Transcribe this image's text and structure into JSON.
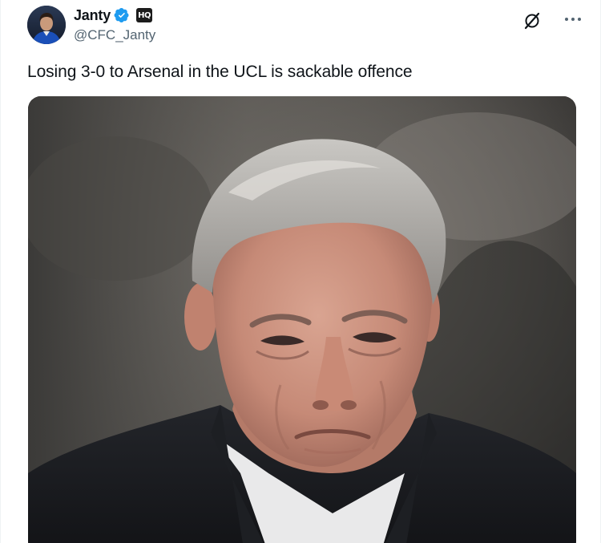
{
  "author": {
    "display_name": "Janty",
    "handle": "@CFC_Janty",
    "badge_label": "HQ",
    "verified_color": "#1d9bf0"
  },
  "tweet": {
    "text": "Losing 3-0 to Arsenal in the UCL is sackable offence"
  },
  "icons": {
    "grok": "grok-icon",
    "more": "more-icon",
    "verified": "verified-badge-icon"
  },
  "media": {
    "alt": "Close-up photo of a grey-haired man in a dark coat and white shirt with a pursed-lip expression"
  }
}
